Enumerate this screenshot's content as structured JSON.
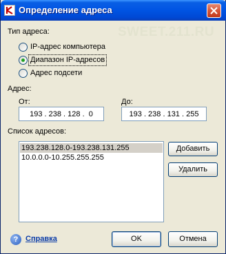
{
  "window": {
    "title": "Определение адреса"
  },
  "watermark": "SWEET.211.RU",
  "address_type": {
    "label": "Тип адреса:",
    "options": [
      {
        "label": "IP-адрес компьютера",
        "selected": false
      },
      {
        "label": "Диапазон IP-адресов",
        "selected": true
      },
      {
        "label": "Адрес подсети",
        "selected": false
      }
    ]
  },
  "address": {
    "label": "Адрес:",
    "from_label": "От:",
    "from_value": "193 . 238 . 128 .  0",
    "to_label": "До:",
    "to_value": "193 . 238 . 131 . 255"
  },
  "address_list": {
    "label": "Список адресов:",
    "items": [
      "193.238.128.0-193.238.131.255",
      "10.0.0.0-10.255.255.255"
    ],
    "selected_index": 0
  },
  "buttons": {
    "add": "Добавить",
    "delete": "Удалить",
    "ok": "OK",
    "cancel": "Отмена"
  },
  "help": {
    "label": "Справка"
  },
  "colors": {
    "title_bar": "#0054e3",
    "dialog_bg": "#ece9d8",
    "accent": "#21a121",
    "link": "#0b3ca8"
  }
}
